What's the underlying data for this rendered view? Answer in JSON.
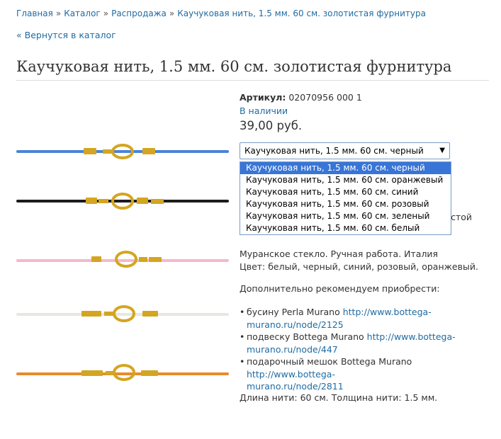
{
  "breadcrumb": {
    "items": [
      "Главная",
      "Каталог",
      "Распродажа",
      "Каучуковая нить, 1.5 мм. 60 см. золотистая фурнитура"
    ],
    "separator": "»"
  },
  "back_link": "« Вернутся в каталог",
  "product": {
    "title": "Каучуковая нить, 1.5 мм. 60 см. золотистая фурнитура",
    "sku_label": "Артикул:",
    "sku_value": "02070956 000 1",
    "stock": "В наличии",
    "price": "39,00 руб.",
    "select": {
      "selected": "Каучуковая нить, 1.5 мм. 60 см. черный",
      "options": [
        "Каучуковая нить, 1.5 мм. 60 см. черный",
        "Каучуковая нить, 1.5 мм. 60 см. оранжевый",
        "Каучуковая нить, 1.5 мм. 60 см. синий",
        "Каучуковая нить, 1.5 мм. 60 см. розовый",
        "Каучуковая нить, 1.5 мм. 60 см. зеленый",
        "Каучуковая нить, 1.5 мм. 60 см. белый"
      ]
    },
    "hidden_text_fragment": "истой",
    "description_line1": "Муранское стекло. Ручная работа. Италия",
    "description_line2": "Цвет: белый, черный, синий, розовый, оранжевый.",
    "recommend_title": "Дополнительно рекомендуем приобрести:",
    "recommendations": [
      {
        "text": "бусину Perla Murano ",
        "link_part1": "http://www.bottega-",
        "link_part2": "murano.ru/node/2125"
      },
      {
        "text": "подвеску Bottega Murano ",
        "link_part1": "http://www.bottega-",
        "link_part2": "murano.ru/node/447"
      },
      {
        "text": "подарочный мешок Bottega Murano ",
        "link_part1": "http://www.bottega-",
        "link_part2": "murano.ru/node/2811"
      }
    ],
    "length_text": "Длина нити: 60 см. Толщина нити: 1.5 мм."
  },
  "colors": {
    "link": "#1f6ba3",
    "selection": "#3875d7",
    "cords": [
      "#4a84d6",
      "#1c1c1c",
      "#f2b8cf",
      "#e8e8e2",
      "#e88a2e"
    ],
    "clasp": "#d4a520"
  }
}
